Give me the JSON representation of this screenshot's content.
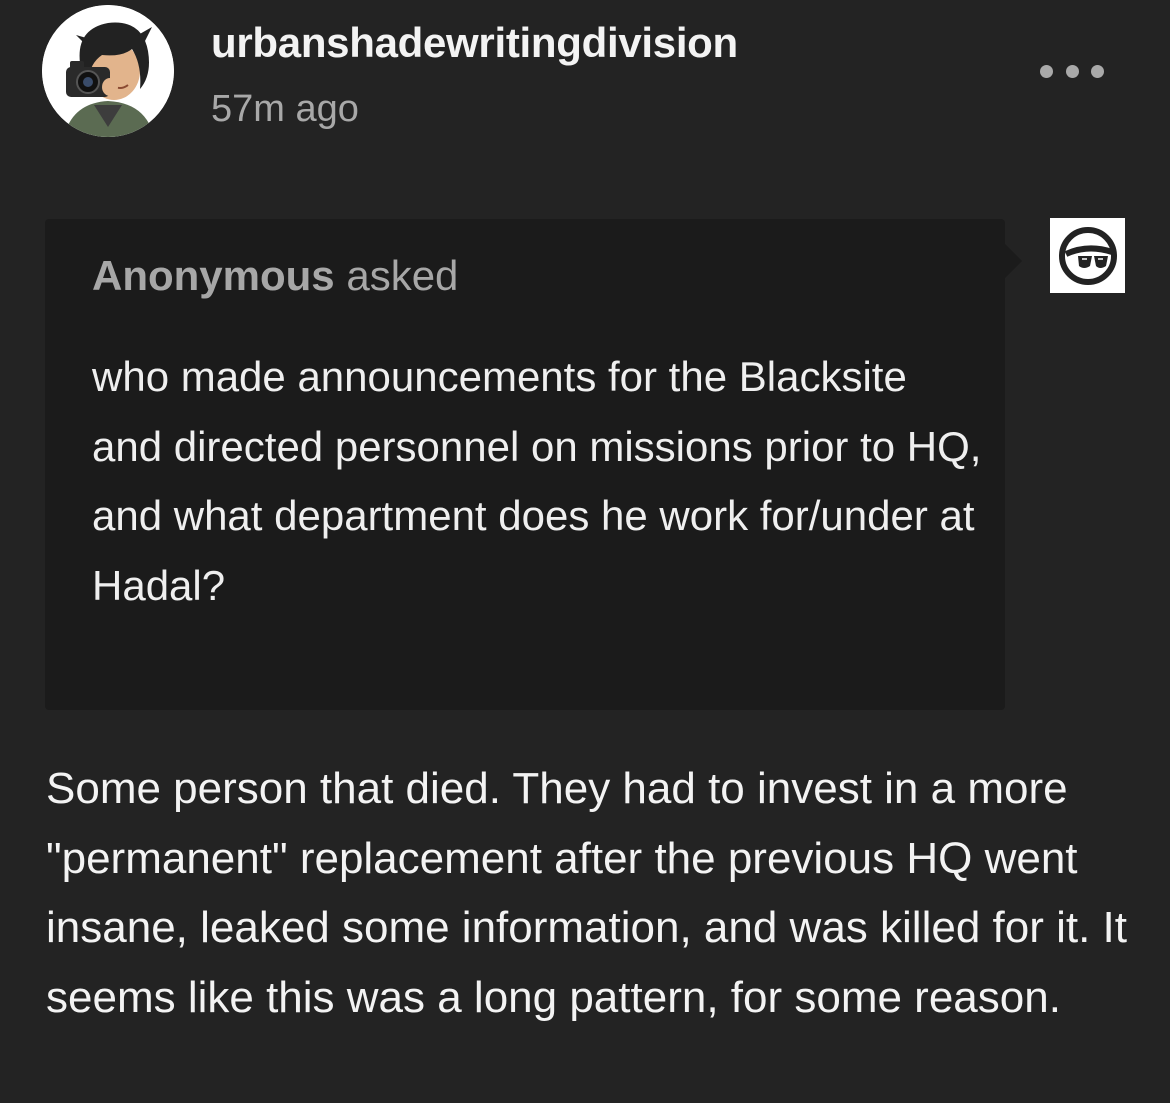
{
  "post": {
    "username": "urbanshadewritingdivision",
    "timestamp": "57m ago",
    "more_icon": "more-horizontal-icon",
    "avatar_icon": "photographer-avatar-icon"
  },
  "ask": {
    "asker_name": "Anonymous",
    "asked_label": "asked",
    "question": "who made announcements for the Blacksite and directed personnel on missions prior to HQ, and what department does he work for/under at Hadal?",
    "asker_avatar_icon": "anonymous-sunglasses-icon"
  },
  "answer": {
    "text": "Some person that died. They had to invest in a more \"permanent\" replacement after the previous HQ went insane, leaked some information, and was killed for it. It seems like this was a long pattern, for some reason."
  },
  "colors": {
    "background": "#232323",
    "ask_box": "#1b1b1b",
    "muted_text": "#a7a7a7",
    "primary_text": "#f2f2f2"
  }
}
